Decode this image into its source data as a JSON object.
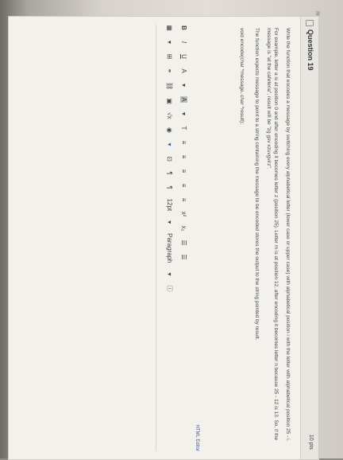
{
  "question": {
    "title": "Question 19",
    "points": "10 pts",
    "paragraph1": "Write the function that encodes a message by switching every alphabetical letter (lower case or upper case) with alphabetical position i with the letter with alphabetical position 25 - i.",
    "paragraph2": "For example, letter a is at position 0 and after encoding it becomes letter z (position 25). Letter m is at position 12, after encoding it becomes letter n because 25 - 12 is 13. So, if the message is \"at the cafeteria\", result will be \"zg gsv xzuvgvirz\".",
    "paragraph3": "The function expects message to point to a string containing the message to be encoded stores the output to the string pointed by result.",
    "signature": "void encode(char *message, char *result);"
  },
  "editor": {
    "label": "HTML Editor",
    "toolbar_row1": [
      "B",
      "I",
      "U",
      "A",
      "▾",
      "A",
      "▾",
      "T",
      "≡",
      "≡",
      "≡",
      "≡",
      "≡",
      "x²",
      "x₂",
      "☰",
      "☰"
    ],
    "toolbar_row2": [
      "▦",
      "▾",
      "⊞",
      "⚭",
      "⛓",
      "▣",
      "√x",
      "◉",
      "▾",
      "⊡",
      "¶",
      "¶",
      "12pt",
      "▾",
      "Paragraph",
      "▾",
      "ⓘ"
    ]
  },
  "corner": "Bluetooth"
}
